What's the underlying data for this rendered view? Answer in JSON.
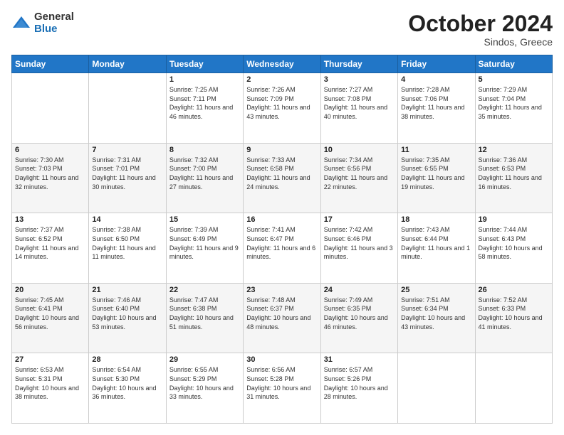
{
  "logo": {
    "general": "General",
    "blue": "Blue"
  },
  "header": {
    "month": "October 2024",
    "location": "Sindos, Greece"
  },
  "weekdays": [
    "Sunday",
    "Monday",
    "Tuesday",
    "Wednesday",
    "Thursday",
    "Friday",
    "Saturday"
  ],
  "weeks": [
    [
      {
        "day": "",
        "sunrise": "",
        "sunset": "",
        "daylight": ""
      },
      {
        "day": "",
        "sunrise": "",
        "sunset": "",
        "daylight": ""
      },
      {
        "day": "1",
        "sunrise": "Sunrise: 7:25 AM",
        "sunset": "Sunset: 7:11 PM",
        "daylight": "Daylight: 11 hours and 46 minutes."
      },
      {
        "day": "2",
        "sunrise": "Sunrise: 7:26 AM",
        "sunset": "Sunset: 7:09 PM",
        "daylight": "Daylight: 11 hours and 43 minutes."
      },
      {
        "day": "3",
        "sunrise": "Sunrise: 7:27 AM",
        "sunset": "Sunset: 7:08 PM",
        "daylight": "Daylight: 11 hours and 40 minutes."
      },
      {
        "day": "4",
        "sunrise": "Sunrise: 7:28 AM",
        "sunset": "Sunset: 7:06 PM",
        "daylight": "Daylight: 11 hours and 38 minutes."
      },
      {
        "day": "5",
        "sunrise": "Sunrise: 7:29 AM",
        "sunset": "Sunset: 7:04 PM",
        "daylight": "Daylight: 11 hours and 35 minutes."
      }
    ],
    [
      {
        "day": "6",
        "sunrise": "Sunrise: 7:30 AM",
        "sunset": "Sunset: 7:03 PM",
        "daylight": "Daylight: 11 hours and 32 minutes."
      },
      {
        "day": "7",
        "sunrise": "Sunrise: 7:31 AM",
        "sunset": "Sunset: 7:01 PM",
        "daylight": "Daylight: 11 hours and 30 minutes."
      },
      {
        "day": "8",
        "sunrise": "Sunrise: 7:32 AM",
        "sunset": "Sunset: 7:00 PM",
        "daylight": "Daylight: 11 hours and 27 minutes."
      },
      {
        "day": "9",
        "sunrise": "Sunrise: 7:33 AM",
        "sunset": "Sunset: 6:58 PM",
        "daylight": "Daylight: 11 hours and 24 minutes."
      },
      {
        "day": "10",
        "sunrise": "Sunrise: 7:34 AM",
        "sunset": "Sunset: 6:56 PM",
        "daylight": "Daylight: 11 hours and 22 minutes."
      },
      {
        "day": "11",
        "sunrise": "Sunrise: 7:35 AM",
        "sunset": "Sunset: 6:55 PM",
        "daylight": "Daylight: 11 hours and 19 minutes."
      },
      {
        "day": "12",
        "sunrise": "Sunrise: 7:36 AM",
        "sunset": "Sunset: 6:53 PM",
        "daylight": "Daylight: 11 hours and 16 minutes."
      }
    ],
    [
      {
        "day": "13",
        "sunrise": "Sunrise: 7:37 AM",
        "sunset": "Sunset: 6:52 PM",
        "daylight": "Daylight: 11 hours and 14 minutes."
      },
      {
        "day": "14",
        "sunrise": "Sunrise: 7:38 AM",
        "sunset": "Sunset: 6:50 PM",
        "daylight": "Daylight: 11 hours and 11 minutes."
      },
      {
        "day": "15",
        "sunrise": "Sunrise: 7:39 AM",
        "sunset": "Sunset: 6:49 PM",
        "daylight": "Daylight: 11 hours and 9 minutes."
      },
      {
        "day": "16",
        "sunrise": "Sunrise: 7:41 AM",
        "sunset": "Sunset: 6:47 PM",
        "daylight": "Daylight: 11 hours and 6 minutes."
      },
      {
        "day": "17",
        "sunrise": "Sunrise: 7:42 AM",
        "sunset": "Sunset: 6:46 PM",
        "daylight": "Daylight: 11 hours and 3 minutes."
      },
      {
        "day": "18",
        "sunrise": "Sunrise: 7:43 AM",
        "sunset": "Sunset: 6:44 PM",
        "daylight": "Daylight: 11 hours and 1 minute."
      },
      {
        "day": "19",
        "sunrise": "Sunrise: 7:44 AM",
        "sunset": "Sunset: 6:43 PM",
        "daylight": "Daylight: 10 hours and 58 minutes."
      }
    ],
    [
      {
        "day": "20",
        "sunrise": "Sunrise: 7:45 AM",
        "sunset": "Sunset: 6:41 PM",
        "daylight": "Daylight: 10 hours and 56 minutes."
      },
      {
        "day": "21",
        "sunrise": "Sunrise: 7:46 AM",
        "sunset": "Sunset: 6:40 PM",
        "daylight": "Daylight: 10 hours and 53 minutes."
      },
      {
        "day": "22",
        "sunrise": "Sunrise: 7:47 AM",
        "sunset": "Sunset: 6:38 PM",
        "daylight": "Daylight: 10 hours and 51 minutes."
      },
      {
        "day": "23",
        "sunrise": "Sunrise: 7:48 AM",
        "sunset": "Sunset: 6:37 PM",
        "daylight": "Daylight: 10 hours and 48 minutes."
      },
      {
        "day": "24",
        "sunrise": "Sunrise: 7:49 AM",
        "sunset": "Sunset: 6:35 PM",
        "daylight": "Daylight: 10 hours and 46 minutes."
      },
      {
        "day": "25",
        "sunrise": "Sunrise: 7:51 AM",
        "sunset": "Sunset: 6:34 PM",
        "daylight": "Daylight: 10 hours and 43 minutes."
      },
      {
        "day": "26",
        "sunrise": "Sunrise: 7:52 AM",
        "sunset": "Sunset: 6:33 PM",
        "daylight": "Daylight: 10 hours and 41 minutes."
      }
    ],
    [
      {
        "day": "27",
        "sunrise": "Sunrise: 6:53 AM",
        "sunset": "Sunset: 5:31 PM",
        "daylight": "Daylight: 10 hours and 38 minutes."
      },
      {
        "day": "28",
        "sunrise": "Sunrise: 6:54 AM",
        "sunset": "Sunset: 5:30 PM",
        "daylight": "Daylight: 10 hours and 36 minutes."
      },
      {
        "day": "29",
        "sunrise": "Sunrise: 6:55 AM",
        "sunset": "Sunset: 5:29 PM",
        "daylight": "Daylight: 10 hours and 33 minutes."
      },
      {
        "day": "30",
        "sunrise": "Sunrise: 6:56 AM",
        "sunset": "Sunset: 5:28 PM",
        "daylight": "Daylight: 10 hours and 31 minutes."
      },
      {
        "day": "31",
        "sunrise": "Sunrise: 6:57 AM",
        "sunset": "Sunset: 5:26 PM",
        "daylight": "Daylight: 10 hours and 28 minutes."
      },
      {
        "day": "",
        "sunrise": "",
        "sunset": "",
        "daylight": ""
      },
      {
        "day": "",
        "sunrise": "",
        "sunset": "",
        "daylight": ""
      }
    ]
  ]
}
